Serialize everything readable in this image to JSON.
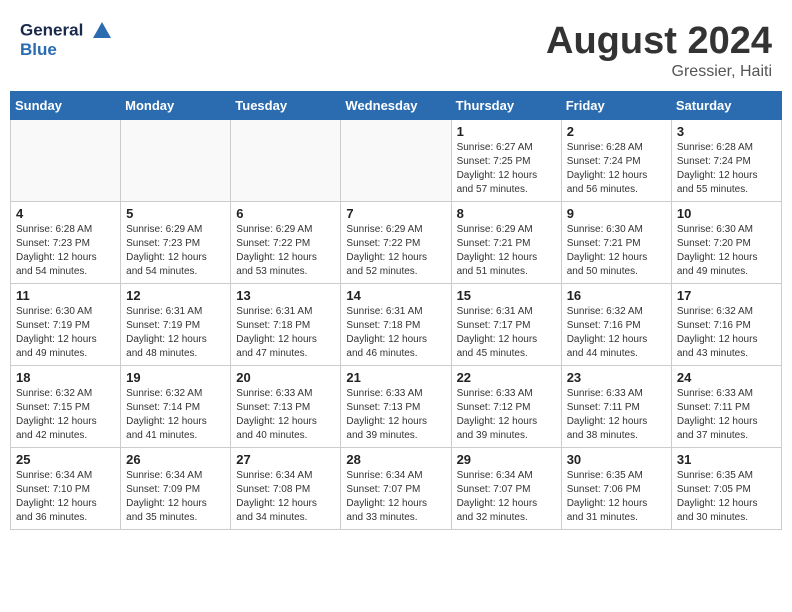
{
  "header": {
    "logo_line1": "General",
    "logo_line2": "Blue",
    "month_title": "August 2024",
    "location": "Gressier, Haiti"
  },
  "days_of_week": [
    "Sunday",
    "Monday",
    "Tuesday",
    "Wednesday",
    "Thursday",
    "Friday",
    "Saturday"
  ],
  "weeks": [
    [
      {
        "day": null
      },
      {
        "day": null
      },
      {
        "day": null
      },
      {
        "day": null
      },
      {
        "day": 1,
        "sunrise": "6:27 AM",
        "sunset": "7:25 PM",
        "daylight": "12 hours and 57 minutes."
      },
      {
        "day": 2,
        "sunrise": "6:28 AM",
        "sunset": "7:24 PM",
        "daylight": "12 hours and 56 minutes."
      },
      {
        "day": 3,
        "sunrise": "6:28 AM",
        "sunset": "7:24 PM",
        "daylight": "12 hours and 55 minutes."
      }
    ],
    [
      {
        "day": 4,
        "sunrise": "6:28 AM",
        "sunset": "7:23 PM",
        "daylight": "12 hours and 54 minutes."
      },
      {
        "day": 5,
        "sunrise": "6:29 AM",
        "sunset": "7:23 PM",
        "daylight": "12 hours and 54 minutes."
      },
      {
        "day": 6,
        "sunrise": "6:29 AM",
        "sunset": "7:22 PM",
        "daylight": "12 hours and 53 minutes."
      },
      {
        "day": 7,
        "sunrise": "6:29 AM",
        "sunset": "7:22 PM",
        "daylight": "12 hours and 52 minutes."
      },
      {
        "day": 8,
        "sunrise": "6:29 AM",
        "sunset": "7:21 PM",
        "daylight": "12 hours and 51 minutes."
      },
      {
        "day": 9,
        "sunrise": "6:30 AM",
        "sunset": "7:21 PM",
        "daylight": "12 hours and 50 minutes."
      },
      {
        "day": 10,
        "sunrise": "6:30 AM",
        "sunset": "7:20 PM",
        "daylight": "12 hours and 49 minutes."
      }
    ],
    [
      {
        "day": 11,
        "sunrise": "6:30 AM",
        "sunset": "7:19 PM",
        "daylight": "12 hours and 49 minutes."
      },
      {
        "day": 12,
        "sunrise": "6:31 AM",
        "sunset": "7:19 PM",
        "daylight": "12 hours and 48 minutes."
      },
      {
        "day": 13,
        "sunrise": "6:31 AM",
        "sunset": "7:18 PM",
        "daylight": "12 hours and 47 minutes."
      },
      {
        "day": 14,
        "sunrise": "6:31 AM",
        "sunset": "7:18 PM",
        "daylight": "12 hours and 46 minutes."
      },
      {
        "day": 15,
        "sunrise": "6:31 AM",
        "sunset": "7:17 PM",
        "daylight": "12 hours and 45 minutes."
      },
      {
        "day": 16,
        "sunrise": "6:32 AM",
        "sunset": "7:16 PM",
        "daylight": "12 hours and 44 minutes."
      },
      {
        "day": 17,
        "sunrise": "6:32 AM",
        "sunset": "7:16 PM",
        "daylight": "12 hours and 43 minutes."
      }
    ],
    [
      {
        "day": 18,
        "sunrise": "6:32 AM",
        "sunset": "7:15 PM",
        "daylight": "12 hours and 42 minutes."
      },
      {
        "day": 19,
        "sunrise": "6:32 AM",
        "sunset": "7:14 PM",
        "daylight": "12 hours and 41 minutes."
      },
      {
        "day": 20,
        "sunrise": "6:33 AM",
        "sunset": "7:13 PM",
        "daylight": "12 hours and 40 minutes."
      },
      {
        "day": 21,
        "sunrise": "6:33 AM",
        "sunset": "7:13 PM",
        "daylight": "12 hours and 39 minutes."
      },
      {
        "day": 22,
        "sunrise": "6:33 AM",
        "sunset": "7:12 PM",
        "daylight": "12 hours and 39 minutes."
      },
      {
        "day": 23,
        "sunrise": "6:33 AM",
        "sunset": "7:11 PM",
        "daylight": "12 hours and 38 minutes."
      },
      {
        "day": 24,
        "sunrise": "6:33 AM",
        "sunset": "7:11 PM",
        "daylight": "12 hours and 37 minutes."
      }
    ],
    [
      {
        "day": 25,
        "sunrise": "6:34 AM",
        "sunset": "7:10 PM",
        "daylight": "12 hours and 36 minutes."
      },
      {
        "day": 26,
        "sunrise": "6:34 AM",
        "sunset": "7:09 PM",
        "daylight": "12 hours and 35 minutes."
      },
      {
        "day": 27,
        "sunrise": "6:34 AM",
        "sunset": "7:08 PM",
        "daylight": "12 hours and 34 minutes."
      },
      {
        "day": 28,
        "sunrise": "6:34 AM",
        "sunset": "7:07 PM",
        "daylight": "12 hours and 33 minutes."
      },
      {
        "day": 29,
        "sunrise": "6:34 AM",
        "sunset": "7:07 PM",
        "daylight": "12 hours and 32 minutes."
      },
      {
        "day": 30,
        "sunrise": "6:35 AM",
        "sunset": "7:06 PM",
        "daylight": "12 hours and 31 minutes."
      },
      {
        "day": 31,
        "sunrise": "6:35 AM",
        "sunset": "7:05 PM",
        "daylight": "12 hours and 30 minutes."
      }
    ]
  ]
}
